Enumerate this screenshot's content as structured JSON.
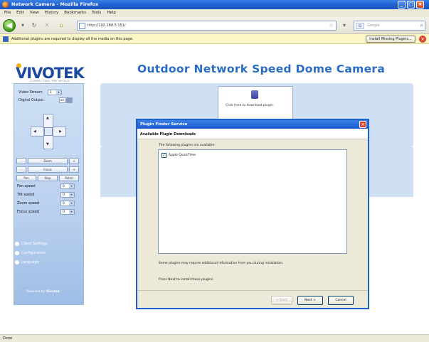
{
  "window": {
    "title": "Network Camera - Mozilla Firefox"
  },
  "menu": [
    "File",
    "Edit",
    "View",
    "History",
    "Bookmarks",
    "Tools",
    "Help"
  ],
  "address": {
    "url": "http://192.168.5.151/"
  },
  "search": {
    "engine": "G",
    "placeholder": "Google"
  },
  "infobar": {
    "message": "Additional plugins are required to display all the media on this page.",
    "button": "Install Missing Plugins..."
  },
  "brand": {
    "logo": "VIVOTEK",
    "tagline": "CONNECTING THE WORLD"
  },
  "page": {
    "title": "Outdoor Network Speed Dome Camera"
  },
  "sidebar": {
    "video_stream_label": "Video Stream",
    "video_stream_value": "1",
    "digital_output_label": "Digital Output",
    "digital_output_on": "on",
    "row1": [
      "-",
      "Zoom",
      "+"
    ],
    "row2": [
      "-",
      "Focus",
      "+"
    ],
    "row3": [
      "Pan",
      "Stop",
      "Patrol"
    ],
    "speeds": [
      {
        "label": "Pan speed",
        "value": "0"
      },
      {
        "label": "Tilt speed",
        "value": "0"
      },
      {
        "label": "Zoom speed",
        "value": "0"
      },
      {
        "label": "Focus speed",
        "value": "0"
      }
    ],
    "links": [
      "Client Settings",
      "Configuration",
      "Language"
    ],
    "powered_by_prefix": "Powered by",
    "powered_by_brand": "Vivotek"
  },
  "plugin_placeholder": {
    "text": "Click here to download plugin."
  },
  "dialog": {
    "title": "Plugin Finder Service",
    "header": "Available Plugin Downloads",
    "note": "The following plugins are available:",
    "plugins": [
      {
        "name": "Apple QuickTime",
        "checked": true
      }
    ],
    "footnote1": "Some plugins may require additional information from you during installation.",
    "footnote2": "Press Next to install these plugins.",
    "buttons": {
      "back": "< Back",
      "next": "Next >",
      "cancel": "Cancel"
    }
  },
  "status": {
    "text": "Done"
  },
  "colors": {
    "accent": "#2a6cc5",
    "titlebar": "#1f5fd0",
    "sidebar": "#b9d0ee"
  }
}
